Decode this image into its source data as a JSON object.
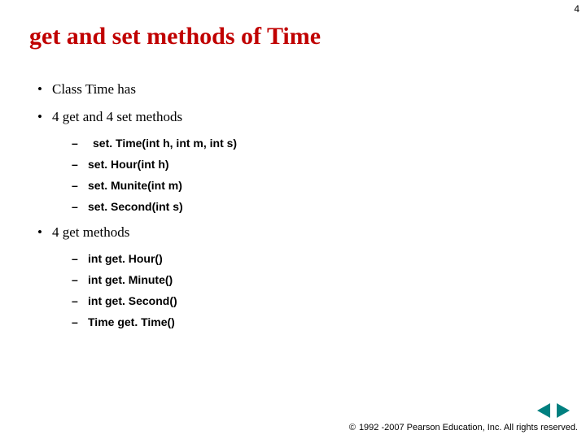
{
  "page_number": "4",
  "title": "get and set methods of Time",
  "bullets": {
    "b1": "Class Time has",
    "b2": "4 get and 4 set methods",
    "b2_sub": {
      "s1": "set. Time(int h, int m, int s)",
      "s2": "set. Hour(int h)",
      "s3": "set. Munite(int m)",
      "s4": "set. Second(int s)"
    },
    "b3": "4 get methods",
    "b3_sub": {
      "s1": "int get. Hour()",
      "s2": "int get. Minute()",
      "s3": "int get. Second()",
      "s4": "Time get. Time()"
    }
  },
  "footer": {
    "copyright_symbol": "©",
    "text": "1992 -2007 Pearson Education, Inc. All rights reserved."
  }
}
